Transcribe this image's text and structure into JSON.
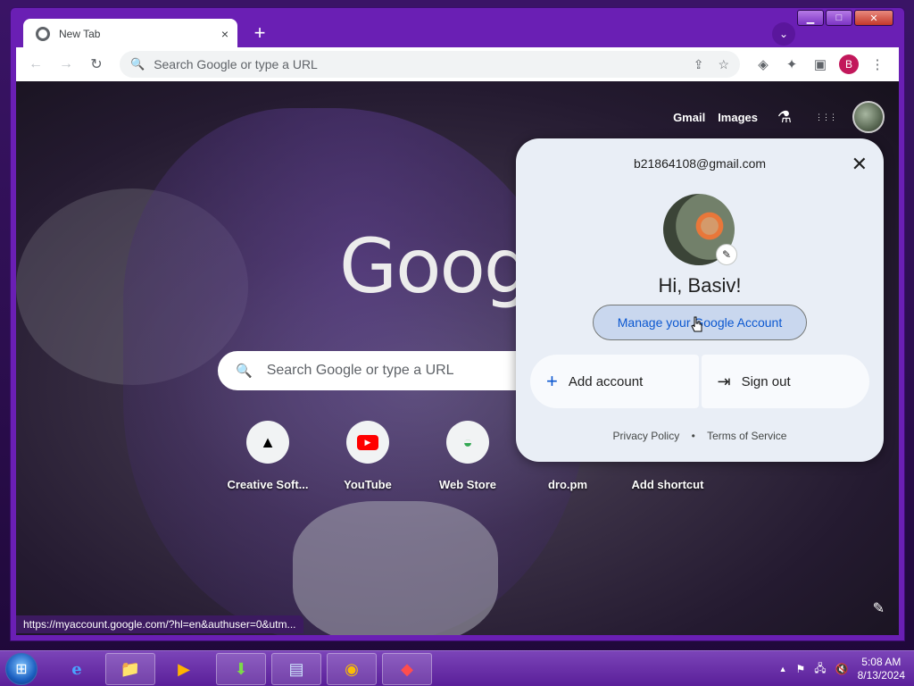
{
  "window": {
    "tab_title": "New Tab",
    "tab_close": "×",
    "new_tab": "+",
    "tab_search": "⌄",
    "controls": {
      "minimize": "▁",
      "maximize": "□",
      "close": "✕"
    }
  },
  "toolbar": {
    "back": "←",
    "forward": "→",
    "reload": "↻",
    "omnibox_placeholder": "Search Google or type a URL",
    "search_icon": "🔍",
    "share": "⇪",
    "star": "☆",
    "extension1": "◈",
    "extensions": "✦",
    "side_panel": "▣",
    "profile_letter": "B",
    "menu": "⋮"
  },
  "ntp": {
    "links": {
      "gmail": "Gmail",
      "images": "Images"
    },
    "labs_icon": "⚗",
    "apps_icon": "⋮⋮⋮",
    "logo": "Goog",
    "search_placeholder": "Search Google or type a URL",
    "search_icon": "🔍",
    "shortcuts": [
      {
        "label": "Creative Soft...",
        "icon": "▲"
      },
      {
        "label": "YouTube",
        "icon": "▶"
      },
      {
        "label": "Web Store",
        "icon": "◒"
      },
      {
        "label": "dro.pm",
        "icon": ""
      },
      {
        "label": "Add shortcut",
        "icon": ""
      }
    ],
    "status_url": "https://myaccount.google.com/?hl=en&authuser=0&utm...",
    "customize_icon": "✎"
  },
  "account_popup": {
    "email": "b21864108@gmail.com",
    "close_icon": "✕",
    "edit_icon": "✎",
    "greeting": "Hi, Basiv!",
    "manage_button": "Manage your Google Account",
    "add_account": "Add account",
    "add_icon": "+",
    "sign_out": "Sign out",
    "sign_out_icon": "⇥",
    "privacy_policy": "Privacy Policy",
    "separator": "•",
    "terms": "Terms of Service"
  },
  "taskbar": {
    "start_icon": "⊞",
    "apps": [
      "e",
      "📁",
      "▶",
      "⬇",
      "▤",
      "◉",
      "◆"
    ],
    "tray": {
      "up_arrow": "▲",
      "flag": "⚑",
      "network": "🖧",
      "volume": "🔇"
    },
    "clock_time": "5:08 AM",
    "clock_date": "8/13/2024"
  }
}
